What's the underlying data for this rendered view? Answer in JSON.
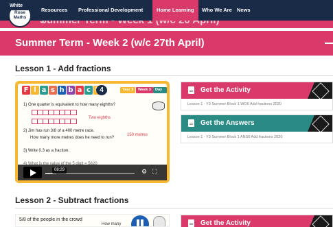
{
  "logo": {
    "line1": "White",
    "line2": "Rose",
    "line3": "Maths"
  },
  "nav": [
    {
      "label": "Resources"
    },
    {
      "label": "Professional Development"
    },
    {
      "label": "Home Learning",
      "active": true
    },
    {
      "label": "Who We Are"
    },
    {
      "label": "News"
    }
  ],
  "accordion": {
    "week1": "Summer Term - Week 1 (w/c 20 April)",
    "week2": "Summer Term - Week 2 (w/c 27th April)"
  },
  "lesson1": {
    "title": "Lesson 1 - Add fractions",
    "video": {
      "brand_letters": [
        "F",
        "l",
        "a",
        "s",
        "h",
        "b",
        "a",
        "c",
        "k"
      ],
      "brand_colors": [
        "#e63946",
        "#f7b731",
        "#2a9d8f",
        "#e76f51",
        "#1a5fb4",
        "#8e44ad",
        "#e63946",
        "#2a9d8f",
        "#f7b731"
      ],
      "number": "4",
      "tags": [
        "Year 3",
        "Week 3",
        "Day 1"
      ],
      "q1": "1)  One quarter is equivalent to how many eighths?",
      "q1_answer": "Two eighths",
      "q2_line1": "2)  Jim has run 3/8 of a 400 metre race.",
      "q2_line2": "How many more metres does he need to run?",
      "q2_answer": "150 metres",
      "q3": "3)  Write 0.3 as a fraction.",
      "q4": "4)  What is the value of the 5 digit = 5820",
      "time": "08:29",
      "progress": 0.12
    },
    "activity": {
      "label": "Get the Activity",
      "file": "Lesson 1 - Y3 Summer Block 1 WO6 Add fractions 2020"
    },
    "answers": {
      "label": "Get the Answers",
      "file": "Lesson 1 - Y3 Summer Block 1 ANS6 Add fractions 2020"
    }
  },
  "lesson2": {
    "title": "Lesson 2 - Subtract fractions",
    "thumb_text": "5/8 of the people in the crowd",
    "thumb_text2": "How many",
    "activity": {
      "label": "Get the Activity"
    }
  },
  "colors": {
    "nav": "#1a2b47",
    "accent": "#d93a6a",
    "teal": "#2a8a84",
    "video_frame": "#f7b731"
  }
}
